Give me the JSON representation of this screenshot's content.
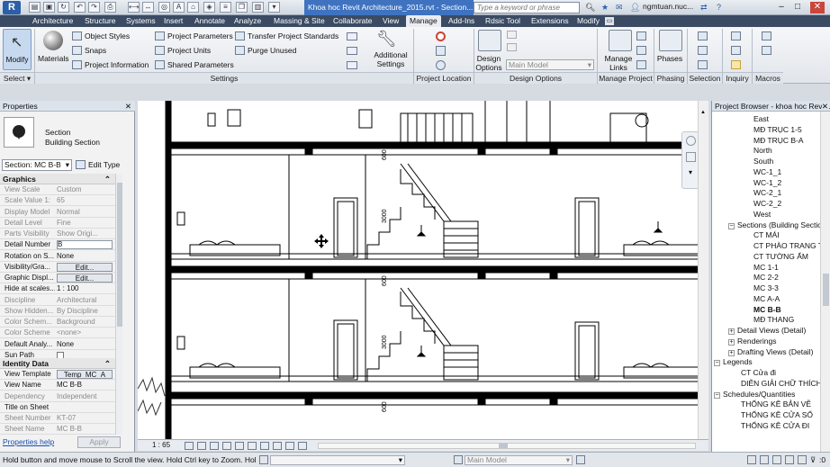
{
  "title_bar": {
    "logo": "R",
    "document_title": "Khoa hoc Revit Architecture_2015.rvt - Section...",
    "search_placeholder": "Type a keyword or phrase",
    "user": "ngmtuan.nuc...",
    "minimize": "–",
    "maximize": "□",
    "close": "✕"
  },
  "tabs": [
    "Architecture",
    "Structure",
    "Systems",
    "Insert",
    "Annotate",
    "Analyze",
    "Massing & Site",
    "Collaborate",
    "View",
    "Manage",
    "Add-Ins",
    "Rdsic Tool",
    "Extensions",
    "Modify"
  ],
  "active_tab": "Manage",
  "ribbon": {
    "modify": "Modify",
    "select": "Select ▾",
    "materials": "Materials",
    "object_styles": "Object  Styles",
    "snaps": "Snaps",
    "project_information": "Project  Information",
    "project_parameters": "Project  Parameters",
    "project_units": "Project  Units",
    "shared_parameters": "Shared  Parameters",
    "transfer_project_standards": "Transfer  Project Standards",
    "purge_unused": "Purge  Unused",
    "additional_settings": "Additional Settings",
    "settings_panel": "Settings",
    "project_location_panel": "Project Location",
    "design_options": "Design Options",
    "main_model": "Main Model",
    "design_options_panel": "Design Options",
    "manage_links": "Manage Links",
    "manage_project_panel": "Manage Project",
    "phases": "Phases",
    "phasing_panel": "Phasing",
    "selection_panel": "Selection",
    "inquiry_panel": "Inquiry",
    "macros_panel": "Macros"
  },
  "properties": {
    "header": "Properties",
    "type_family": "Section",
    "type_name": "Building Section",
    "type_selector": "Section: MC B-B",
    "edit_type": "Edit Type",
    "graphics_header": "Graphics",
    "identity_header": "Identity Data",
    "rows_graphics": [
      {
        "name": "View Scale",
        "value": "Custom",
        "grey": true
      },
      {
        "name": "Scale Value 1:",
        "value": "65",
        "grey": true
      },
      {
        "name": "Display Model",
        "value": "Normal",
        "grey": true
      },
      {
        "name": "Detail Level",
        "value": "Fine",
        "grey": true
      },
      {
        "name": "Parts Visibility",
        "value": "Show Origi...",
        "grey": true
      },
      {
        "name": "Detail Number",
        "value": "B",
        "grey": false
      },
      {
        "name": "Rotation on S...",
        "value": "None",
        "grey": false
      },
      {
        "name": "Visibility/Gra...",
        "value": "Edit...",
        "grey": false
      },
      {
        "name": "Graphic Displ...",
        "value": "Edit...",
        "grey": false
      },
      {
        "name": "Hide at scales...",
        "value": "1 : 100",
        "grey": false
      },
      {
        "name": "Discipline",
        "value": "Architectural",
        "grey": true
      },
      {
        "name": "Show Hidden...",
        "value": "By Discipline",
        "grey": true
      },
      {
        "name": "Color Schem...",
        "value": "Background",
        "grey": true
      },
      {
        "name": "Color Scheme",
        "value": "<none>",
        "grey": true
      },
      {
        "name": "Default Analy...",
        "value": "None",
        "grey": false
      },
      {
        "name": "Sun Path",
        "value": "",
        "grey": false
      }
    ],
    "rows_identity": [
      {
        "name": "View Template",
        "value": "Temp_MC_A",
        "grey": false
      },
      {
        "name": "View Name",
        "value": "MC B-B",
        "grey": false
      },
      {
        "name": "Dependency",
        "value": "Independent",
        "grey": true
      },
      {
        "name": "Title on Sheet",
        "value": "",
        "grey": false
      },
      {
        "name": "Sheet Number",
        "value": "KT-07",
        "grey": true
      },
      {
        "name": "Sheet Name",
        "value": "MC B-B",
        "grey": true
      }
    ],
    "help_link": "Properties help",
    "apply": "Apply"
  },
  "canvas": {
    "dims": [
      "600",
      "3000",
      "600",
      "3000",
      "600"
    ],
    "scale": "1 : 65"
  },
  "browser": {
    "header": "Project Browser - khoa hoc Revi...",
    "items": [
      {
        "label": "East",
        "indent": 46,
        "bold": false,
        "toggle": ""
      },
      {
        "label": "MĐ TRỤC 1-5",
        "indent": 46,
        "bold": false,
        "toggle": ""
      },
      {
        "label": "MĐ TRỤC B-A",
        "indent": 46,
        "bold": false,
        "toggle": ""
      },
      {
        "label": "North",
        "indent": 46,
        "bold": false,
        "toggle": ""
      },
      {
        "label": "South",
        "indent": 46,
        "bold": false,
        "toggle": ""
      },
      {
        "label": "WC-1_1",
        "indent": 46,
        "bold": false,
        "toggle": ""
      },
      {
        "label": "WC-1_2",
        "indent": 46,
        "bold": false,
        "toggle": ""
      },
      {
        "label": "WC-2_1",
        "indent": 46,
        "bold": false,
        "toggle": ""
      },
      {
        "label": "WC-2_2",
        "indent": 46,
        "bold": false,
        "toggle": ""
      },
      {
        "label": "West",
        "indent": 46,
        "bold": false,
        "toggle": ""
      },
      {
        "label": "Sections (Building Sectio",
        "indent": 18,
        "bold": false,
        "toggle": "−"
      },
      {
        "label": "CT MÁI",
        "indent": 46,
        "bold": false,
        "toggle": ""
      },
      {
        "label": "CT PHÀO TRANG TR",
        "indent": 46,
        "bold": false,
        "toggle": ""
      },
      {
        "label": "CT TƯỜNG ẨM",
        "indent": 46,
        "bold": false,
        "toggle": ""
      },
      {
        "label": "MC 1-1",
        "indent": 46,
        "bold": false,
        "toggle": ""
      },
      {
        "label": "MC 2-2",
        "indent": 46,
        "bold": false,
        "toggle": ""
      },
      {
        "label": "MC 3-3",
        "indent": 46,
        "bold": false,
        "toggle": ""
      },
      {
        "label": "MC A-A",
        "indent": 46,
        "bold": false,
        "toggle": ""
      },
      {
        "label": "MC B-B",
        "indent": 46,
        "bold": true,
        "toggle": ""
      },
      {
        "label": "MĐ THANG",
        "indent": 46,
        "bold": false,
        "toggle": ""
      },
      {
        "label": "Detail Views (Detail)",
        "indent": 18,
        "bold": false,
        "toggle": "+"
      },
      {
        "label": "Renderings",
        "indent": 18,
        "bold": false,
        "toggle": "+"
      },
      {
        "label": "Drafting Views (Detail)",
        "indent": 18,
        "bold": false,
        "toggle": "+"
      },
      {
        "label": "Legends",
        "indent": 2,
        "bold": false,
        "toggle": "−"
      },
      {
        "label": "CT Cửa đi",
        "indent": 32,
        "bold": false,
        "toggle": ""
      },
      {
        "label": "DIỄN GIẢI CHỮ THÍCH",
        "indent": 32,
        "bold": false,
        "toggle": ""
      },
      {
        "label": "Schedules/Quantities",
        "indent": 2,
        "bold": false,
        "toggle": "−"
      },
      {
        "label": "THỐNG KÊ BẢN VẼ",
        "indent": 32,
        "bold": false,
        "toggle": ""
      },
      {
        "label": "THỐNG KÊ CỬA SỔ",
        "indent": 32,
        "bold": false,
        "toggle": ""
      },
      {
        "label": "THỐNG KÊ CỬA ĐI",
        "indent": 32,
        "bold": false,
        "toggle": ""
      }
    ]
  },
  "status_bar": {
    "message": "Hold button and move mouse to Scroll the view. Hold Ctrl key to Zoom. Hold S",
    "main_model": "Main Model",
    "zero": ":0"
  }
}
